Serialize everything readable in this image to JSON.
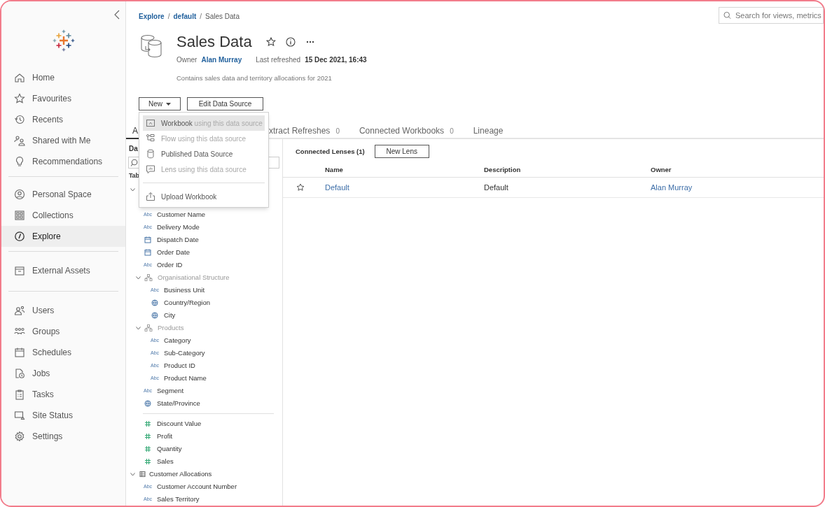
{
  "breadcrumbs": [
    {
      "label": "Explore",
      "link": true
    },
    {
      "separator": "/",
      "label": "default",
      "link": true
    },
    {
      "separator": "/",
      "label": "Sales Data",
      "link": false
    }
  ],
  "search": {
    "placeholder": "Search for views, metrics"
  },
  "sidebar": {
    "groups": [
      [
        {
          "label": "Home",
          "selected": false
        },
        {
          "label": "Favourites",
          "selected": false
        },
        {
          "label": "Recents",
          "selected": false
        },
        {
          "label": "Shared with Me",
          "selected": false
        },
        {
          "label": "Recommendations",
          "selected": false
        }
      ],
      [
        {
          "label": "Personal Space",
          "selected": false
        },
        {
          "label": "Collections",
          "selected": false
        },
        {
          "label": "Explore",
          "selected": true
        }
      ],
      [
        {
          "label": "External Assets",
          "selected": false
        }
      ],
      [
        {
          "label": "Users",
          "selected": false
        },
        {
          "label": "Groups",
          "selected": false
        },
        {
          "label": "Schedules",
          "selected": false
        },
        {
          "label": "Jobs",
          "selected": false
        },
        {
          "label": "Tasks",
          "selected": false
        },
        {
          "label": "Site Status",
          "selected": false
        },
        {
          "label": "Settings",
          "selected": false
        }
      ]
    ]
  },
  "header": {
    "title": "Sales Data",
    "favorite": false,
    "owner_label": "Owner",
    "owner": "Alan Murray",
    "refreshed_label": "Last refreshed",
    "refreshed": "15 Dec 2021, 16:43",
    "description": "Contains sales data and territory allocations for 2021"
  },
  "buttons": [
    {
      "label": "New",
      "dropdown": true
    },
    {
      "label": "Edit Data Source",
      "dropdown": false
    }
  ],
  "menu": {
    "items": [
      {
        "kind": "item",
        "label": "Workbook",
        "suffix": " using this data source",
        "selected": true,
        "disabled": false
      },
      {
        "kind": "item",
        "label": "Flow",
        "suffix": " using this data source",
        "selected": false,
        "disabled": true
      },
      {
        "kind": "item",
        "label": "Published Data Source",
        "selected": false,
        "disabled": false
      },
      {
        "kind": "item",
        "label": "Lens",
        "suffix": " using this data source",
        "selected": false,
        "disabled": true
      },
      {
        "kind": "divider"
      },
      {
        "kind": "item",
        "label": "Upload Workbook",
        "selected": false,
        "disabled": false
      }
    ]
  },
  "tabs": [
    {
      "label": "A",
      "selected": true
    },
    {
      "label": "xtract Refreshes",
      "count": "0",
      "selected": false
    },
    {
      "label": "Connected Workbooks",
      "count": "0",
      "selected": false
    },
    {
      "label": "Lineage",
      "selected": false
    }
  ],
  "data_panel": {
    "heading": "Da",
    "tables_label": "Tab",
    "tables": [
      {
        "expanded": true,
        "children": [
          {
            "kind": "string",
            "icon": "Abc",
            "label": "Customer Name"
          },
          {
            "kind": "string",
            "icon": "Abc",
            "label": "Delivery Mode"
          },
          {
            "kind": "date",
            "label": "Dispatch Date"
          },
          {
            "kind": "date",
            "label": "Order Date"
          },
          {
            "kind": "string",
            "icon": "Abc",
            "label": "Order ID"
          },
          {
            "kind": "hierarchy",
            "label": "Organisational Structure",
            "expanded": true,
            "children": [
              {
                "kind": "string",
                "icon": "Abc",
                "label": "Business Unit"
              },
              {
                "kind": "geo",
                "label": "Country/Region"
              },
              {
                "kind": "geo",
                "label": "City"
              }
            ]
          },
          {
            "kind": "hierarchy",
            "label": "Products",
            "expanded": true,
            "children": [
              {
                "kind": "string",
                "icon": "Abc",
                "label": "Category"
              },
              {
                "kind": "string",
                "icon": "Abc",
                "label": "Sub-Category"
              },
              {
                "kind": "string",
                "icon": "Abc",
                "label": "Product ID"
              },
              {
                "kind": "string",
                "icon": "Abc",
                "label": "Product Name"
              }
            ]
          },
          {
            "kind": "string",
            "icon": "Abc",
            "label": "Segment"
          },
          {
            "kind": "geo",
            "label": "State/Province"
          },
          {
            "kind": "divider"
          },
          {
            "kind": "number",
            "label": "Discount Value"
          },
          {
            "kind": "number",
            "label": "Profit"
          },
          {
            "kind": "number",
            "label": "Quantity"
          },
          {
            "kind": "number",
            "label": "Sales"
          }
        ]
      },
      {
        "label": "Customer Allocations",
        "expanded": true,
        "children": [
          {
            "kind": "string",
            "icon": "Abc",
            "label": "Customer Account Number"
          },
          {
            "kind": "string",
            "icon": "Abc",
            "label": "Sales Territory"
          }
        ]
      }
    ]
  },
  "lenses": {
    "title": "Connected Lenses (1)",
    "button": "New Lens",
    "columns": [
      "Name",
      "Description",
      "Owner"
    ],
    "rows": [
      {
        "favorite": false,
        "name": "Default",
        "description": "Default",
        "owner": "Alan Murray"
      }
    ]
  }
}
